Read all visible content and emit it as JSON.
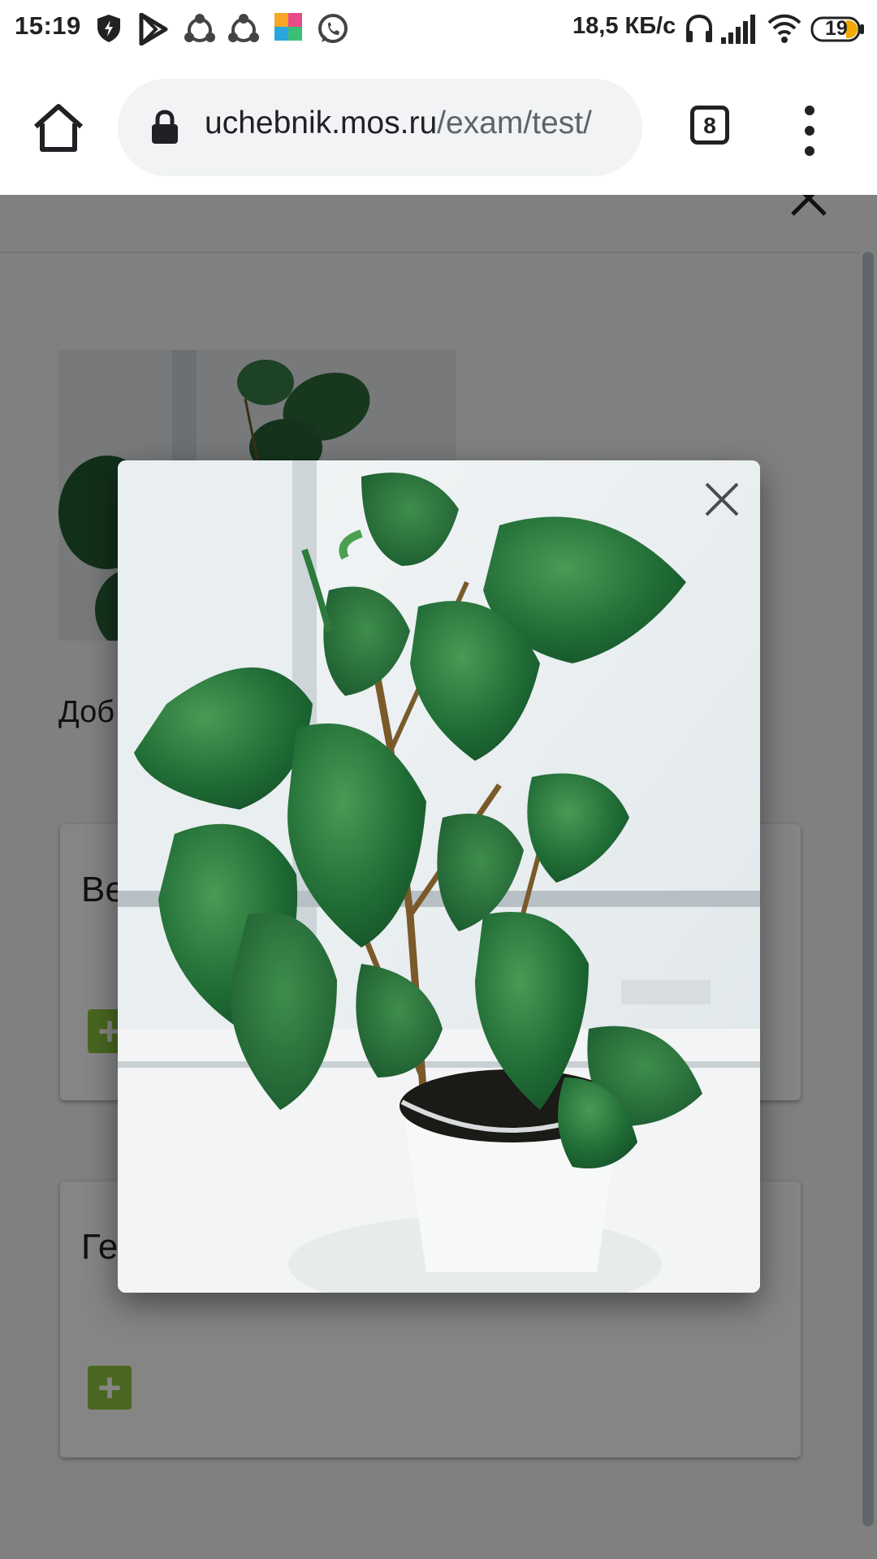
{
  "status_bar": {
    "time": "15:19",
    "speed": "18,5 КБ/с",
    "battery": "19",
    "icons": [
      "shield-icon",
      "play-store-icon",
      "sync-icon",
      "sync-icon",
      "app-icon",
      "whatsapp-icon",
      "headphones-icon",
      "signal-icon",
      "wifi-icon",
      "battery-icon"
    ]
  },
  "browser": {
    "url_host": "uchebnik.mos.ru",
    "url_path": "/exam/test/",
    "tab_count": "8"
  },
  "page": {
    "prompt_text": "Доб",
    "cards": [
      {
        "title": "Ве",
        "add_label": "+"
      },
      {
        "title": "Ге",
        "add_label": "+"
      }
    ]
  },
  "modal": {
    "image_label": "plant-photo",
    "close_icon": "close-icon"
  },
  "colors": {
    "accent_green": "#8dc63f",
    "overlay": "rgba(0,0,0,0.48)"
  }
}
